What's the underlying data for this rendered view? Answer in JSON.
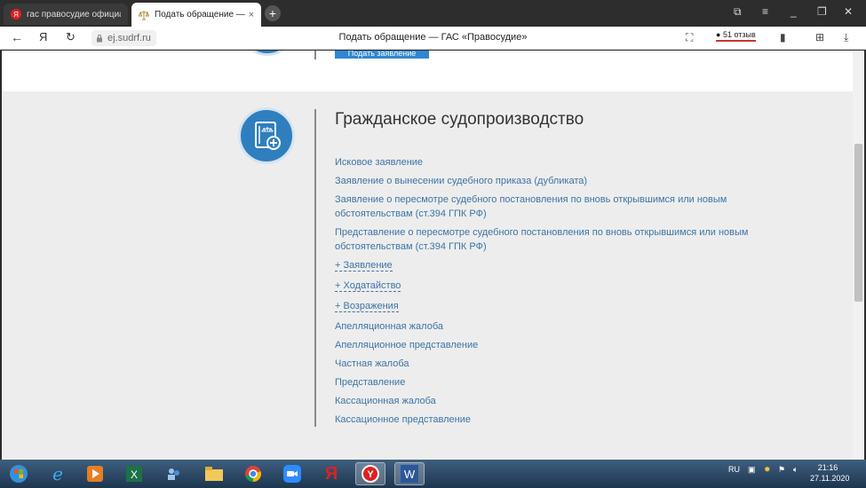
{
  "browser": {
    "tabs": [
      {
        "title": "гас правосудие официаль",
        "active": false
      },
      {
        "title": "Подать обращение — ГАС «Пр",
        "active": true
      }
    ],
    "yandex_label": "Я",
    "url": "ej.sudrf.ru",
    "page_title": "Подать обращение — ГАС «Правосудие»",
    "reviews": "51 отзыв"
  },
  "page": {
    "prev_button": "Подать заявление",
    "section_title": "Гражданское судопроизводство",
    "links": [
      {
        "label": "Исковое заявление",
        "dashed": false
      },
      {
        "label": "Заявление о вынесении судебного приказа (дубликата)",
        "dashed": false
      },
      {
        "label": "Заявление о пересмотре судебного постановления по вновь открывшимся или новым обстоятельствам (ст.394 ГПК РФ)",
        "dashed": false
      },
      {
        "label": "Представление о пересмотре судебного постановления по вновь открывшимся или новым обстоятельствам (ст.394 ГПК РФ)",
        "dashed": false
      },
      {
        "label": "+ Заявление",
        "dashed": true
      },
      {
        "label": "+ Ходатайство",
        "dashed": true
      },
      {
        "label": "+ Возражения",
        "dashed": true
      },
      {
        "label": "Апелляционная жалоба",
        "dashed": false
      },
      {
        "label": "Апелляционное представление",
        "dashed": false
      },
      {
        "label": "Частная жалоба",
        "dashed": false
      },
      {
        "label": "Представление",
        "dashed": false
      },
      {
        "label": "Кассационная жалоба",
        "dashed": false
      },
      {
        "label": "Кассационное представление",
        "dashed": false
      }
    ]
  },
  "taskbar": {
    "lang": "RU",
    "time": "21:16",
    "date": "27.11.2020"
  },
  "colors": {
    "link": "#3d74a8",
    "accent_circle": "#2f7fbf",
    "page_bg": "#ededed"
  }
}
